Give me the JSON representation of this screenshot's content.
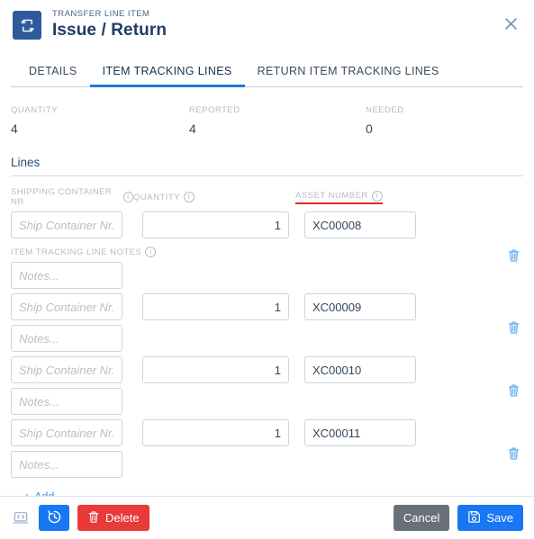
{
  "header": {
    "eyebrow": "TRANSFER LINE ITEM",
    "title": "Issue / Return",
    "icon": "transfer-arrows-icon",
    "close_icon": "close-icon",
    "icon_bg": "#2e5a9c"
  },
  "tabs": [
    {
      "label": "DETAILS",
      "active": false
    },
    {
      "label": "ITEM TRACKING LINES",
      "active": true
    },
    {
      "label": "RETURN ITEM TRACKING LINES",
      "active": false
    }
  ],
  "summary": [
    {
      "label": "QUANTITY",
      "value": "4"
    },
    {
      "label": "REPORTED",
      "value": "4"
    },
    {
      "label": "NEEDED",
      "value": "0"
    }
  ],
  "lines_section": {
    "heading": "Lines",
    "columns": [
      {
        "label": "SHIPPING CONTAINER NR",
        "info": true,
        "error_underline": false
      },
      {
        "label": "QUANTITY",
        "info": true,
        "error_underline": false
      },
      {
        "label": "ASSET NUMBER",
        "info": true,
        "error_underline": true
      }
    ],
    "notes_label": "ITEM TRACKING LINE NOTES",
    "ship_placeholder": "Ship Container Nr...",
    "notes_placeholder": "Notes...",
    "delete_icon": "trash-icon",
    "add_label": "Add",
    "add_icon": "plus-icon",
    "rows": [
      {
        "ship_container": "",
        "quantity": "1",
        "asset_number": "XC00008",
        "notes": ""
      },
      {
        "ship_container": "",
        "quantity": "1",
        "asset_number": "XC00009",
        "notes": ""
      },
      {
        "ship_container": "",
        "quantity": "1",
        "asset_number": "XC00010",
        "notes": ""
      },
      {
        "ship_container": "",
        "quantity": "1",
        "asset_number": "XC00011",
        "notes": ""
      }
    ]
  },
  "footer": {
    "code_icon": "code-laptop-icon",
    "history_icon": "history-clock-icon",
    "delete_label": "Delete",
    "delete_icon": "trash-icon",
    "cancel_label": "Cancel",
    "save_label": "Save",
    "save_icon": "floppy-save-icon"
  },
  "colors": {
    "accent_blue": "#1877f2",
    "tab_active": "#1b7ad6",
    "danger_red": "#e8393b",
    "error_underline": "#e02a29",
    "header_navy": "#2e5a9c",
    "muted": "#b4bcc6"
  }
}
